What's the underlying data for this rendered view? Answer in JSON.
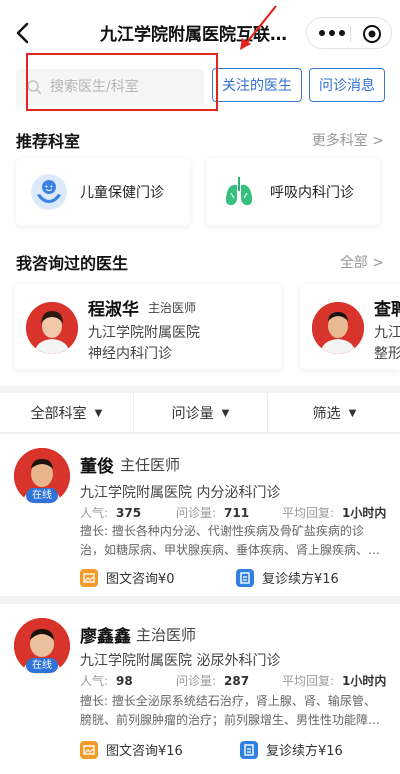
{
  "header": {
    "title": "九江学院附属医院互联…"
  },
  "search": {
    "placeholder": "搜索医生/科室",
    "followed_label": "关注的医生",
    "messages_label": "问诊消息"
  },
  "recommended": {
    "title": "推荐科室",
    "more": "更多科室 >",
    "items": [
      {
        "name": "儿童保健门诊",
        "icon": "child-care-icon"
      },
      {
        "name": "呼吸内科门诊",
        "icon": "lungs-icon"
      }
    ]
  },
  "consulted": {
    "title": "我咨询过的医生",
    "more": "全部 >",
    "items": [
      {
        "name": "程淑华",
        "title": "主治医师",
        "hospital": "九江学院附属医院",
        "dept": "神经内科门诊"
      },
      {
        "name": "查聘",
        "title": "",
        "hospital": "九江",
        "dept": "整形"
      }
    ]
  },
  "filters": [
    {
      "label": "全部科室"
    },
    {
      "label": "问诊量"
    },
    {
      "label": "筛选"
    }
  ],
  "doctors": [
    {
      "name": "董俊",
      "title": "主任医师",
      "hospital": "九江学院附属医院 内分泌科门诊",
      "online": "在线",
      "popularity_label": "人气:",
      "popularity": "375",
      "volume_label": "问诊量:",
      "volume": "711",
      "reply_label": "平均回复:",
      "reply": "1小时内",
      "skill_line1": "擅长: 擅长各种内分泌、代谢性疾病及骨矿盐疾病的诊",
      "skill_line2": "治，如糖尿病、甲状腺疾病、垂体疾病、肾上腺疾病、…",
      "svc1": "图文咨询¥0",
      "svc2": "复诊续方¥16"
    },
    {
      "name": "廖鑫鑫",
      "title": "主治医师",
      "hospital": "九江学院附属医院 泌尿外科门诊",
      "online": "在线",
      "popularity_label": "人气:",
      "popularity": "98",
      "volume_label": "问诊量:",
      "volume": "287",
      "reply_label": "平均回复:",
      "reply": "1小时内",
      "skill_line1": "擅长: 擅长全泌尿系统结石治疗，肾上腺、肾、输尿管、",
      "skill_line2": "膀胱、前列腺肿瘤的治疗；前列腺增生、男性性功能障…",
      "svc1": "图文咨询¥16",
      "svc2": "复诊续方¥16"
    }
  ],
  "colors": {
    "accent": "#2f6fd1",
    "annotation_red": "#e0261e",
    "online_badge": "#2f72d8",
    "service_orange": "#f39b28",
    "service_blue": "#2f80e0"
  }
}
